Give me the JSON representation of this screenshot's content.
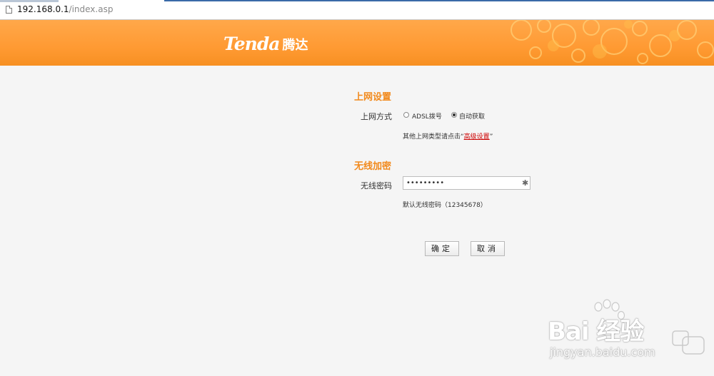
{
  "browser": {
    "url_host": "192.168.0.1",
    "url_path": "/index.asp"
  },
  "header": {
    "brand": "Tenda",
    "brand_cn": "腾达",
    "background_color": "#ff9a33"
  },
  "internet": {
    "title": "上网设置",
    "mode_label": "上网方式",
    "options": [
      {
        "label": "ADSL拨号",
        "selected": false
      },
      {
        "label": "自动获取",
        "selected": true
      }
    ],
    "hint_prefix": "其他上网类型请点击“",
    "hint_link": "高级设置",
    "hint_suffix": "”"
  },
  "wireless": {
    "title": "无线加密",
    "password_label": "无线密码",
    "password_value": "•••••••••",
    "default_hint": "默认无线密码（12345678）"
  },
  "buttons": {
    "ok": "确定",
    "cancel": "取消"
  },
  "watermark": {
    "text": "Bai 经验",
    "url": "jingyan.baidu.com"
  },
  "colors": {
    "accent": "#f28a1d",
    "link": "#cc0000"
  }
}
